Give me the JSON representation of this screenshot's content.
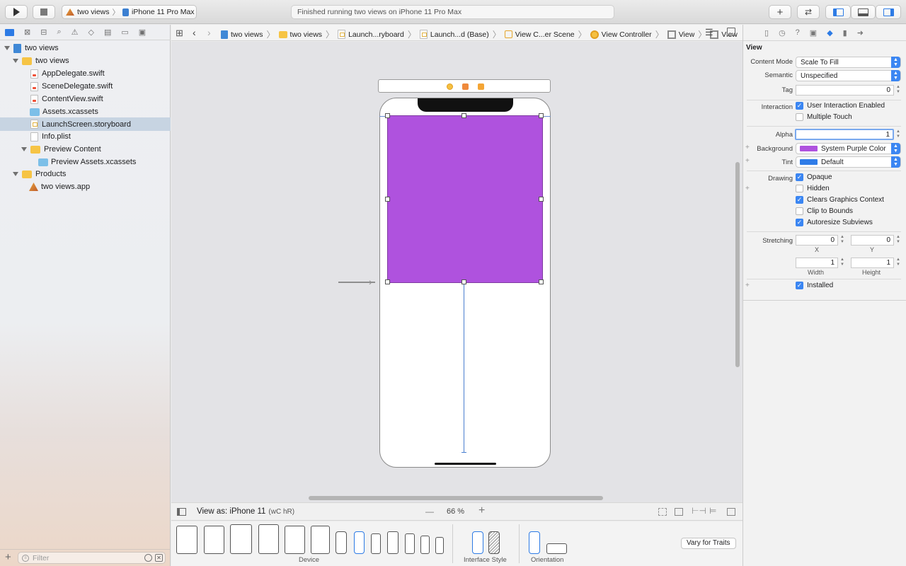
{
  "toolbar": {
    "scheme": "two views",
    "device": "iPhone 11 Pro Max",
    "status": "Finished running two views on iPhone 11 Pro Max"
  },
  "navigator": {
    "tree": [
      {
        "label": "two views",
        "icon": "project-icon"
      },
      {
        "label": "two views",
        "icon": "folder-icon"
      },
      {
        "label": "AppDelegate.swift",
        "icon": "swift-file-icon"
      },
      {
        "label": "SceneDelegate.swift",
        "icon": "swift-file-icon"
      },
      {
        "label": "ContentView.swift",
        "icon": "swift-file-icon"
      },
      {
        "label": "Assets.xcassets",
        "icon": "asset-catalog-icon"
      },
      {
        "label": "LaunchScreen.storyboard",
        "icon": "storyboard-icon"
      },
      {
        "label": "Info.plist",
        "icon": "plist-icon"
      },
      {
        "label": "Preview Content",
        "icon": "folder-icon"
      },
      {
        "label": "Preview Assets.xcassets",
        "icon": "asset-catalog-icon"
      },
      {
        "label": "Products",
        "icon": "folder-icon"
      },
      {
        "label": "two views.app",
        "icon": "app-icon"
      }
    ],
    "filter_placeholder": "Filter"
  },
  "breadcrumb": [
    "two views",
    "two views",
    "Launch...ryboard",
    "Launch...d (Base)",
    "View C...er Scene",
    "View Controller",
    "View",
    "View"
  ],
  "canvas": {
    "view_as": "View as: iPhone 11",
    "size_class": "(wC hR)",
    "zoom": "66 %",
    "minus": "—",
    "plus": "+",
    "device_section": "Device",
    "interface_style_section": "Interface Style",
    "orientation_section": "Orientation",
    "vary_for_traits": "Vary for Traits",
    "purple_view_color": "#af52de"
  },
  "inspector": {
    "section": "View",
    "content_mode_label": "Content Mode",
    "content_mode": "Scale To Fill",
    "semantic_label": "Semantic",
    "semantic": "Unspecified",
    "tag_label": "Tag",
    "tag": "0",
    "interaction_label": "Interaction",
    "user_interaction": "User Interaction Enabled",
    "multiple_touch": "Multiple Touch",
    "alpha_label": "Alpha",
    "alpha": "1",
    "background_label": "Background",
    "background": "System Purple Color",
    "background_color": "#af52de",
    "tint_label": "Tint",
    "tint": "Default",
    "tint_color": "#2f7ce8",
    "drawing_label": "Drawing",
    "opaque": "Opaque",
    "hidden": "Hidden",
    "clears_graphics": "Clears Graphics Context",
    "clip_to_bounds": "Clip to Bounds",
    "autoresize": "Autoresize Subviews",
    "stretching_label": "Stretching",
    "stretch_x": "0",
    "stretch_y": "0",
    "x_label": "X",
    "y_label": "Y",
    "stretch_w": "1",
    "stretch_h": "1",
    "width_label": "Width",
    "height_label": "Height",
    "installed": "Installed"
  }
}
